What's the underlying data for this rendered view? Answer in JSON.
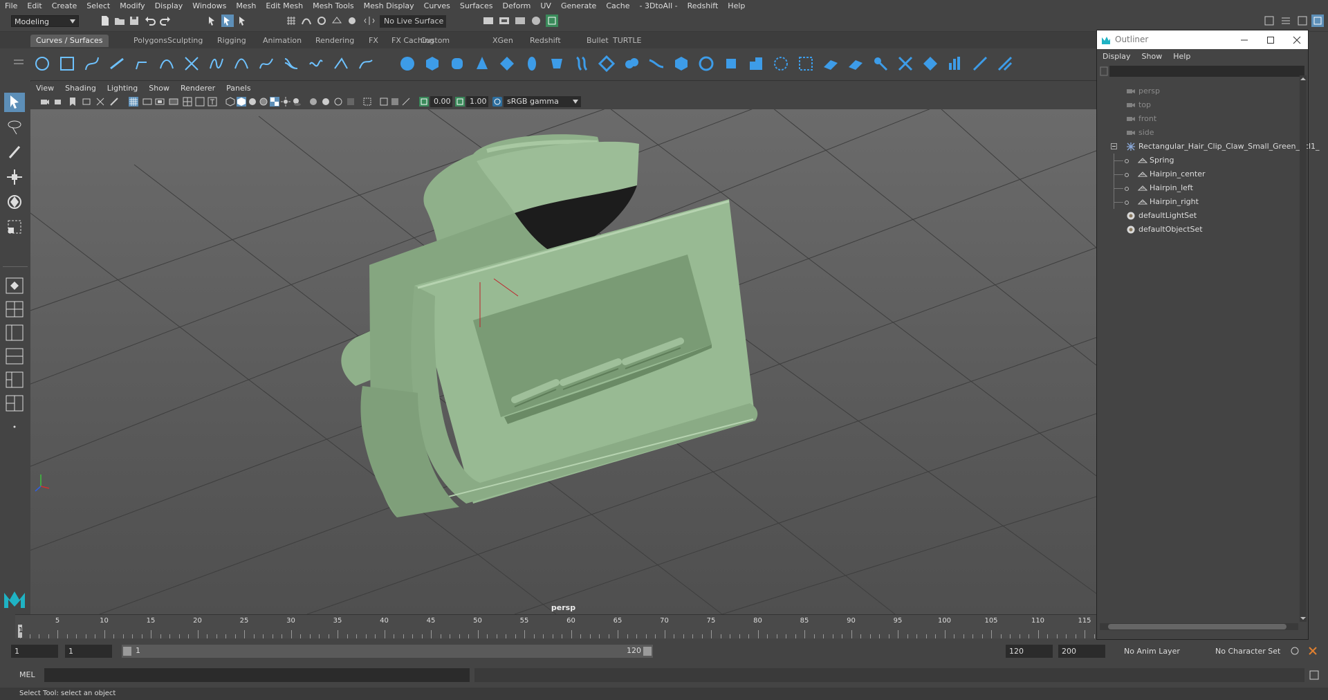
{
  "menubar": [
    "File",
    "Edit",
    "Create",
    "Select",
    "Modify",
    "Display",
    "Windows",
    "Mesh",
    "Edit Mesh",
    "Mesh Tools",
    "Mesh Display",
    "Curves",
    "Surfaces",
    "Deform",
    "UV",
    "Generate",
    "Cache",
    "- 3DtoAll -",
    "Redshift",
    "Help"
  ],
  "statusline": {
    "mode": "Modeling",
    "live_surface": "No Live Surface"
  },
  "shelf_tabs": [
    "Curves / Surfaces",
    "Polygons",
    "Sculpting",
    "Rigging",
    "Animation",
    "Rendering",
    "FX",
    "FX Caching",
    "Custom",
    "XGen",
    "Redshift",
    "Bullet",
    "TURTLE"
  ],
  "viewport": {
    "menus": [
      "View",
      "Shading",
      "Lighting",
      "Show",
      "Renderer",
      "Panels"
    ],
    "exposure": "0.00",
    "gamma": "1.00",
    "color_space": "sRGB gamma",
    "camera_label": "persp"
  },
  "outliner": {
    "title": "Outliner",
    "menus": [
      "Display",
      "Show",
      "Help"
    ],
    "items": [
      {
        "label": "persp",
        "icon": "camera-icon",
        "dim": true,
        "indent": 0
      },
      {
        "label": "top",
        "icon": "camera-icon",
        "dim": true,
        "indent": 0
      },
      {
        "label": "front",
        "icon": "camera-icon",
        "dim": true,
        "indent": 0
      },
      {
        "label": "side",
        "icon": "camera-icon",
        "dim": true,
        "indent": 0
      },
      {
        "label": "Rectangular_Hair_Clip_Claw_Small_Green_ncl1_",
        "icon": "group-icon",
        "dim": false,
        "indent": 0
      },
      {
        "label": "Spring",
        "icon": "mesh-icon",
        "dim": false,
        "indent": 1
      },
      {
        "label": "Hairpin_center",
        "icon": "mesh-icon",
        "dim": false,
        "indent": 1
      },
      {
        "label": "Hairpin_left",
        "icon": "mesh-icon",
        "dim": false,
        "indent": 1
      },
      {
        "label": "Hairpin_right",
        "icon": "mesh-icon",
        "dim": false,
        "indent": 1
      },
      {
        "label": "defaultLightSet",
        "icon": "set-icon",
        "dim": false,
        "indent": 0
      },
      {
        "label": "defaultObjectSet",
        "icon": "set-icon",
        "dim": false,
        "indent": 0
      }
    ]
  },
  "timeslider": {
    "ticks": [
      "5",
      "10",
      "15",
      "20",
      "25",
      "30",
      "35",
      "40",
      "45",
      "50",
      "55",
      "60",
      "65",
      "70",
      "75",
      "80",
      "85",
      "90",
      "95",
      "100",
      "105",
      "110",
      "115"
    ],
    "current_frame": "1"
  },
  "range": {
    "start": "1",
    "current": "1",
    "slider_start": "1",
    "slider_end": "120",
    "end": "120",
    "max": "200",
    "anim_layer": "No Anim Layer",
    "character_set": "No Character Set"
  },
  "cmdline": {
    "label": "MEL"
  },
  "helpline": {
    "text": "Select Tool: select an object"
  }
}
